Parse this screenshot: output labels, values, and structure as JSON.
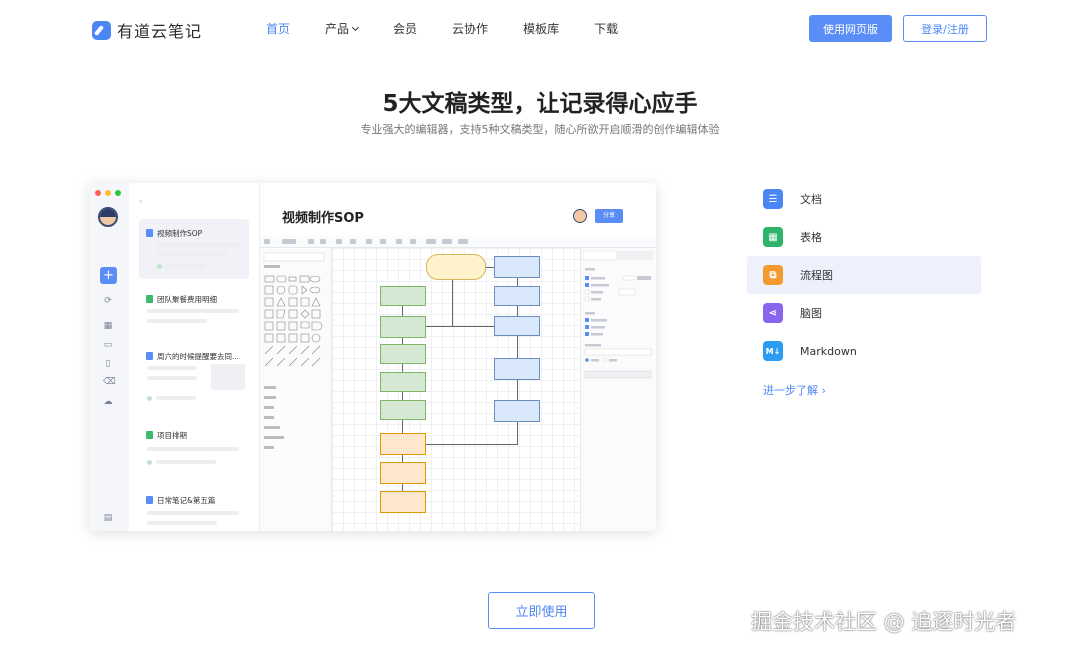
{
  "header": {
    "logo_text": "有道云笔记",
    "nav": [
      {
        "label": "首页",
        "active": true
      },
      {
        "label": "产品",
        "dropdown": true
      },
      {
        "label": "会员"
      },
      {
        "label": "云协作"
      },
      {
        "label": "模板库"
      },
      {
        "label": "下载"
      }
    ],
    "web_button": "使用网页版",
    "login_button": "登录/注册"
  },
  "hero": {
    "title": "5大文稿类型，让记录得心应手",
    "subtitle": "专业强大的编辑器，支持5种文稿类型，随心所欲开启顺滑的创作编辑体验"
  },
  "mockup": {
    "notes": [
      {
        "title": "视频制作SOP",
        "icon_color": "#5a8ef6",
        "selected": true
      },
      {
        "title": "团队聚餐费用明细",
        "icon_color": "#3dba6f"
      },
      {
        "title": "周六的时候提醒要去同...",
        "icon_color": "#5a8ef6"
      },
      {
        "title": "项目排期",
        "icon_color": "#3dba6f"
      },
      {
        "title": "日常笔记&第五篇",
        "icon_color": "#5a8ef6"
      }
    ],
    "doc_title": "视频制作SOP",
    "share_label": "分享"
  },
  "types": {
    "items": [
      {
        "label": "文档",
        "icon": "doc-icon",
        "color": "#4c86f4",
        "glyph": "☰"
      },
      {
        "label": "表格",
        "icon": "table-icon",
        "color": "#2fb36b",
        "glyph": "▦"
      },
      {
        "label": "流程图",
        "icon": "flowchart-icon",
        "color": "#f39a2f",
        "glyph": "⧉",
        "active": true
      },
      {
        "label": "脑图",
        "icon": "mindmap-icon",
        "color": "#8a63ee",
        "glyph": "⋖"
      },
      {
        "label": "Markdown",
        "icon": "markdown-icon",
        "color": "#2c9cf2",
        "glyph": "M↓"
      }
    ],
    "more_link": "进一步了解"
  },
  "cta": {
    "label": "立即使用"
  },
  "watermark": "掘金技术社区 @ 追逐时光者"
}
